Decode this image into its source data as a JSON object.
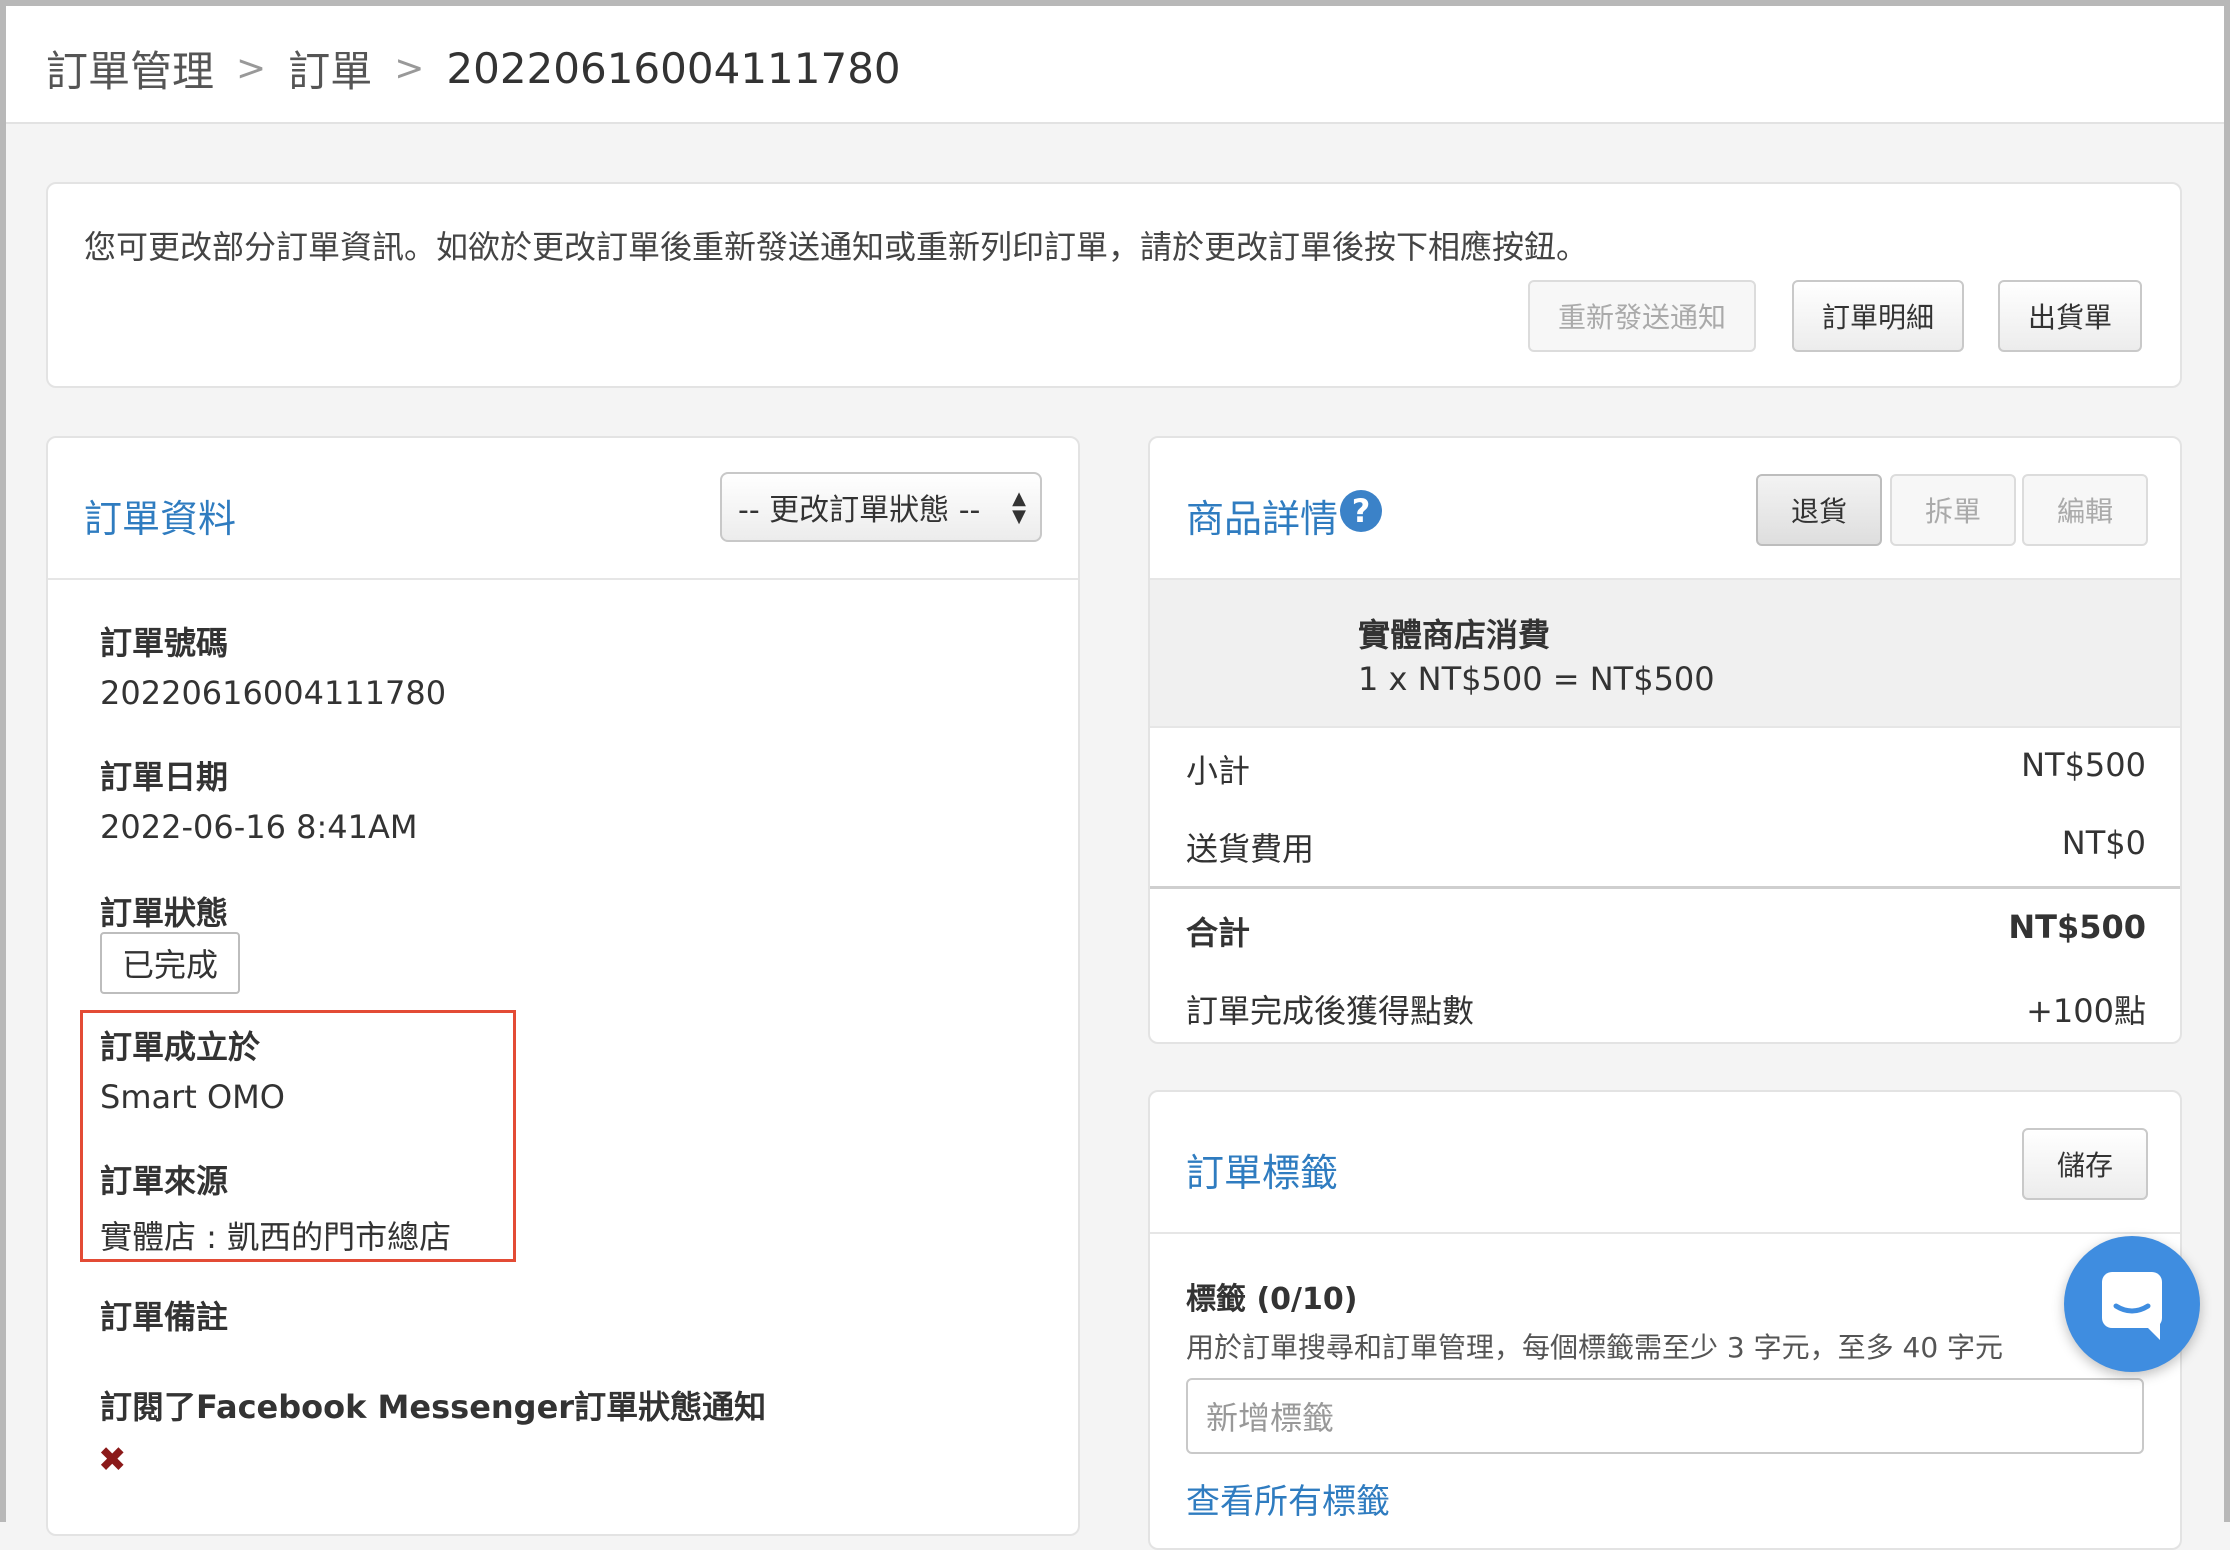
{
  "breadcrumb": {
    "level1": "訂單管理",
    "level2": "訂單",
    "current": "20220616004111780",
    "separator": ">"
  },
  "notice": {
    "text": "您可更改部分訂單資訊。如欲於更改訂單後重新發送通知或重新列印訂單，請於更改訂單後按下相應按鈕。",
    "resend_label": "重新發送通知",
    "detail_label": "訂單明細",
    "shipping_label": "出貨單"
  },
  "order_info": {
    "title": "訂單資料",
    "status_select": "-- 更改訂單狀態 --",
    "number_label": "訂單號碼",
    "number_value": "20220616004111780",
    "date_label": "訂單日期",
    "date_value": "2022-06-16 8:41AM",
    "status_label": "訂單狀態",
    "status_value": "已完成",
    "created_label": "訂單成立於",
    "created_value": "Smart OMO",
    "source_label": "訂單來源",
    "source_value": "實體店 : 凱西的門市總店",
    "remark_label": "訂單備註",
    "messenger_label": "訂閱了Facebook Messenger訂單狀態通知",
    "messenger_mark": "✖"
  },
  "product_detail": {
    "title": "商品詳情",
    "help_glyph": "?",
    "return_label": "退貨",
    "split_label": "拆單",
    "edit_label": "編輯",
    "item_name": "實體商店消費",
    "item_line": "1 x NT$500 = NT$500",
    "subtotal_label": "小計",
    "subtotal_value": "NT$500",
    "shipping_label": "送貨費用",
    "shipping_value": "NT$0",
    "total_label": "合計",
    "total_value": "NT$500",
    "points_label": "訂單完成後獲得點數",
    "points_value": "+100點"
  },
  "order_tags": {
    "title": "訂單標籤",
    "save_label": "儲存",
    "count_label": "標籤 (0/10)",
    "hint": "用於訂單搜尋和訂單管理，每個標籤需至少 3 字元，至多 40 字元",
    "input_placeholder": "新增標籤",
    "view_all_label": "查看所有標籤"
  },
  "icons": {
    "chevron": "chevron-right-icon",
    "help": "help-circle-icon",
    "chat": "chat-bubble-icon",
    "select_arrows": "sort-arrows-icon"
  },
  "colors": {
    "accent": "#2f7cc0",
    "highlight_border": "#e34b35",
    "chat_button": "#3f8de0",
    "cross_mark": "#8b1a1a"
  }
}
